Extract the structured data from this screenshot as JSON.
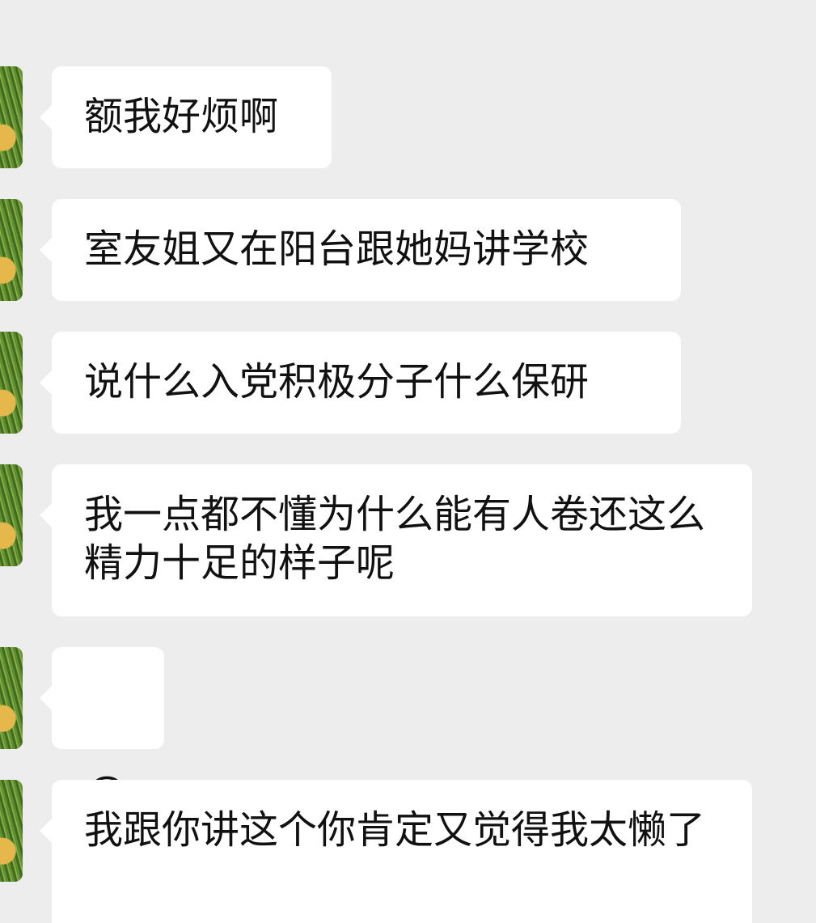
{
  "chat": {
    "messages": [
      {
        "text": "额我好烦啊"
      },
      {
        "text": "室友姐又在阳台跟她妈讲学校"
      },
      {
        "text": "说什么入党积极分子什么保研"
      },
      {
        "text": "我一点都不懂为什么能有人卷还这么精力十足的样子呢"
      },
      {
        "text": "😅"
      },
      {
        "text": "我跟你讲这个你肯定又觉得我太懒了"
      }
    ]
  }
}
